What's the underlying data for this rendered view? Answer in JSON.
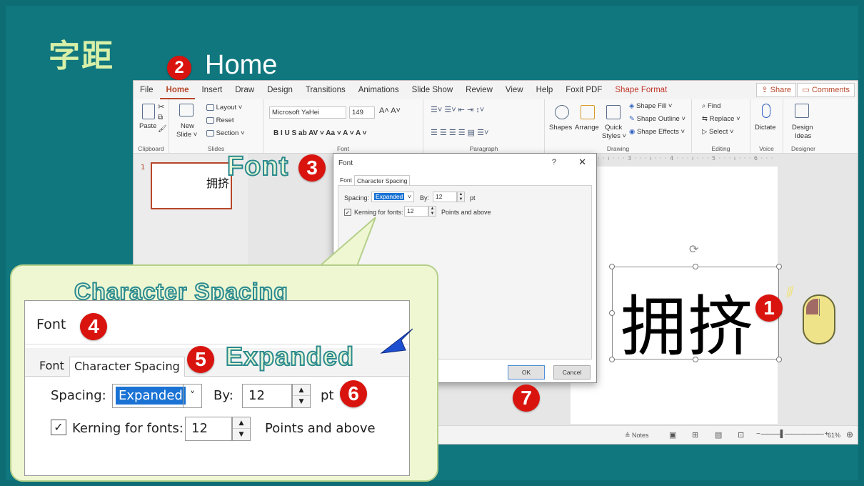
{
  "slide": {
    "title": "字距",
    "steps": {
      "s1": "1",
      "s2": "2",
      "s3": "3",
      "s4": "4",
      "s5": "5",
      "s6": "6",
      "s7": "7"
    },
    "home_label": "Home",
    "font_label": "Font",
    "char_spacing_label": "Character  Spacing",
    "expanded_label": "Expanded"
  },
  "menubar": {
    "items": [
      "File",
      "Home",
      "Insert",
      "Draw",
      "Design",
      "Transitions",
      "Animations",
      "Slide Show",
      "Review",
      "View",
      "Help",
      "Foxit PDF",
      "Shape Format"
    ],
    "share": "Share",
    "comments": "Comments"
  },
  "ribbon": {
    "clipboard": {
      "paste": "Paste",
      "label": "Clipboard"
    },
    "slides": {
      "new_slide": "New",
      "new_slide2": "Slide ˅",
      "layout": "Layout ˅",
      "reset": "Reset",
      "section": "Section ˅",
      "label": "Slides"
    },
    "font": {
      "name": "Microsoft YaHei",
      "size": "149",
      "label": "Font",
      "row2": "B  I  U  S  ab  AV ˅  Aa ˅   A ˅   A ˅"
    },
    "paragraph": {
      "label": "Paragraph"
    },
    "drawing": {
      "shapes": "Shapes",
      "arrange": "Arrange",
      "quick": "Quick",
      "styles": "Styles ˅",
      "fill": "Shape Fill ˅",
      "outline": "Shape Outline ˅",
      "effects": "Shape Effects ˅",
      "label": "Drawing"
    },
    "editing": {
      "find": "Find",
      "replace": "Replace ˅",
      "select": "Select ˅",
      "label": "Editing"
    },
    "voice": {
      "dictate": "Dictate",
      "label": "Voice"
    },
    "designer": {
      "design": "Design",
      "ideas": "Ideas",
      "label": "Designer"
    }
  },
  "thumbnail": {
    "number": "1",
    "text": "拥挤"
  },
  "canvas": {
    "text": "拥挤",
    "ruler": "· · · 2 · · · ı · · · 3 · · · ı · · · 4 · · · ı · · · 5 · · · ı · · · 6 · · ·"
  },
  "statusbar": {
    "notes": "Notes",
    "zoom": "61%"
  },
  "dialog": {
    "title": "Font",
    "help": "?",
    "close": "✕",
    "tab_font": "Font",
    "tab_char": "Character Spacing",
    "spacing_label": "Spacing:",
    "spacing_value": "Expanded",
    "by_label": "By:",
    "by_value": "12",
    "unit": "pt",
    "kerning_label": "Kerning for fonts:",
    "kerning_value": "12",
    "kerning_suffix": "Points and above",
    "ok": "OK",
    "cancel": "Cancel"
  },
  "zoom_dialog": {
    "title": "Font",
    "tab_font": "Font",
    "tab_char": "Character Spacing",
    "spacing_label": "Spacing:",
    "spacing_value": "Expanded",
    "by_label": "By:",
    "by_value": "12",
    "unit": "pt",
    "kerning_label": "Kerning for fonts:",
    "kerning_value": "12",
    "kerning_suffix": "Points and above"
  }
}
